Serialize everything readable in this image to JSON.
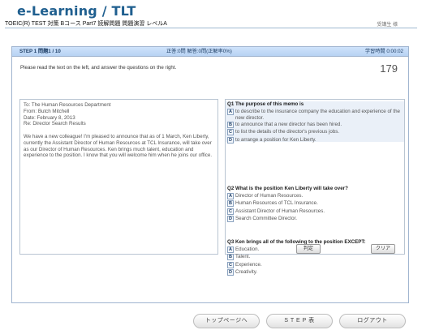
{
  "app": {
    "title": "e-Learning / TLT",
    "breadcrumb": "TOEIC(R) TEST 対策 Bコース Part7 読解問題 問題演習 レベルA",
    "user_name": "受講生 様"
  },
  "step_header": {
    "step": "STEP 1 問題1 / 10",
    "answers": "正答:0問 解答:0問(正解率0%)",
    "elapsed": "学習時間 0:00:02"
  },
  "instruction": "Please read the text on the left, and answer the questions on the right.",
  "countdown": "179",
  "passage": {
    "header_lines": [
      "To: The Human Resources Department",
      "From: Butch Mitchell",
      "Date: February 8, 2013",
      "Re: Director Search Results"
    ],
    "body": "We have a new colleague! I'm pleased to announce that as of 1 March, Ken Liberty, currently the Assistant Director of Human Resources at TCL Insurance, will take over as our Director of Human Resources. Ken brings much talent, education and experience to the position. I know that you will welcome him when he joins our office."
  },
  "questions": [
    {
      "text": "Q1  The purpose of this memo is",
      "options": [
        {
          "letter": "A",
          "text": "to describe to the insurance company the education and experience of the new director."
        },
        {
          "letter": "B",
          "text": "to announce that a new director has been hired."
        },
        {
          "letter": "C",
          "text": "to list the details of the director's previous jobs."
        },
        {
          "letter": "D",
          "text": "to arrange a position for Ken Liberty."
        }
      ]
    },
    {
      "text": "Q2  What is the position Ken Liberty will take over?",
      "options": [
        {
          "letter": "A",
          "text": "Director of Human Resources."
        },
        {
          "letter": "B",
          "text": "Human Resources of TCL Insurance."
        },
        {
          "letter": "C",
          "text": "Assistant Director of Human Resources."
        },
        {
          "letter": "D",
          "text": "Search Committee Director."
        }
      ]
    },
    {
      "text": "Q3  Ken brings all of the following to the position EXCEPT:",
      "options": [
        {
          "letter": "A",
          "text": "Education."
        },
        {
          "letter": "B",
          "text": "Talent."
        },
        {
          "letter": "C",
          "text": "Experience."
        },
        {
          "letter": "D",
          "text": "Creativity."
        }
      ]
    }
  ],
  "buttons": {
    "judge": "判定",
    "clear": "クリア"
  },
  "footer": {
    "top_page": "トップページへ",
    "step_table": "S T E P 表",
    "logout": "ログアウト"
  }
}
